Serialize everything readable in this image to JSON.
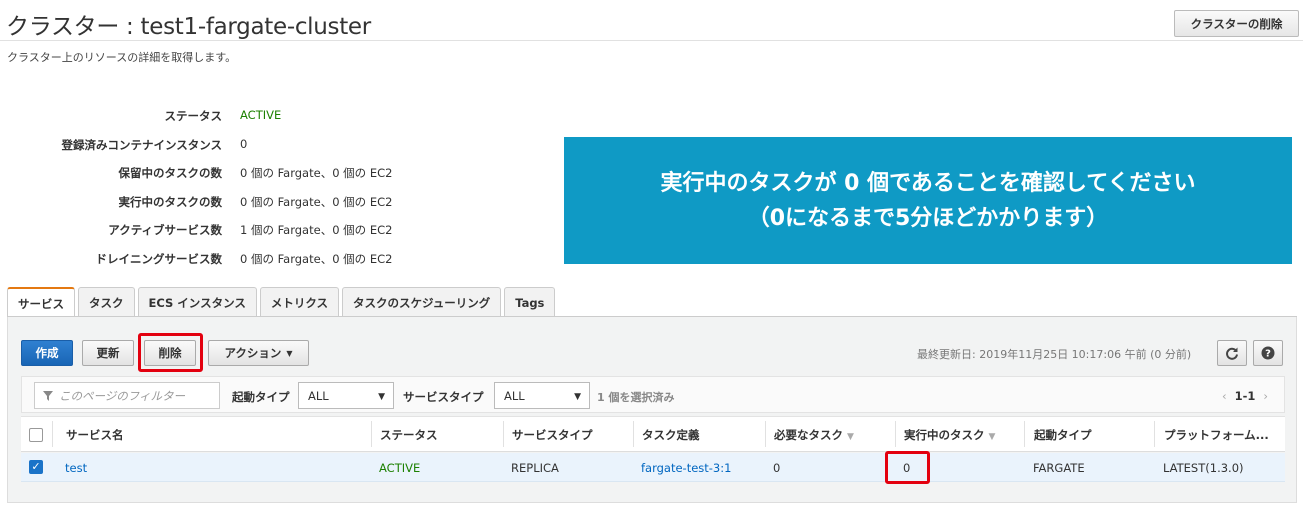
{
  "header": {
    "title": "クラスター : test1-fargate-cluster",
    "subtitle": "クラスター上のリソースの詳細を取得します。",
    "delete_cluster_label": "クラスターの削除"
  },
  "details": [
    {
      "label": "ステータス",
      "value": "ACTIVE"
    },
    {
      "label": "登録済みコンテナインスタンス",
      "value": "0"
    },
    {
      "label": "保留中のタスクの数",
      "value": "0 個の Fargate、0 個の EC2"
    },
    {
      "label": "実行中のタスクの数",
      "value": "0 個の Fargate、0 個の EC2"
    },
    {
      "label": "アクティブサービス数",
      "value": "1 個の Fargate、0 個の EC2"
    },
    {
      "label": "ドレイニングサービス数",
      "value": "0 個の Fargate、0 個の EC2"
    }
  ],
  "banner": {
    "line1": "実行中のタスクが 0 個であることを確認してください",
    "line2": "（0になるまで5分ほどかかります）"
  },
  "tabs": [
    "サービス",
    "タスク",
    "ECS インスタンス",
    "メトリクス",
    "タスクのスケジューリング",
    "Tags"
  ],
  "selected_tab": "サービス",
  "toolbar": {
    "create_label": "作成",
    "refresh_label": "更新",
    "delete_label": "削除",
    "actions_label": "アクション",
    "last_updated": "最終更新日: 2019年11月25日 10:17:06 午前 (0 分前)"
  },
  "filters": {
    "search_placeholder": "このページのフィルター",
    "launch_type_label": "起動タイプ",
    "launch_type_value": "ALL",
    "service_type_label": "サービスタイプ",
    "service_type_value": "ALL",
    "selected_count": "1 個を選択済み",
    "pager": "1-1"
  },
  "table": {
    "columns": [
      "サービス名",
      "ステータス",
      "サービスタイプ",
      "タスク定義",
      "必要なタスク",
      "実行中のタスク",
      "起動タイプ",
      "プラットフォーム..."
    ],
    "rows": [
      {
        "service_name": "test",
        "status": "ACTIVE",
        "service_type": "REPLICA",
        "task_definition": "fargate-test-3:1",
        "desired": "0",
        "running": "0",
        "launch_type": "FARGATE",
        "platform": "LATEST(1.3.0)"
      }
    ]
  },
  "colors": {
    "active": "#1d8102",
    "banner_bg": "#0f9ac5",
    "link": "#0066c0",
    "highlight": "#e3000f",
    "primary": "#1a73c8"
  }
}
